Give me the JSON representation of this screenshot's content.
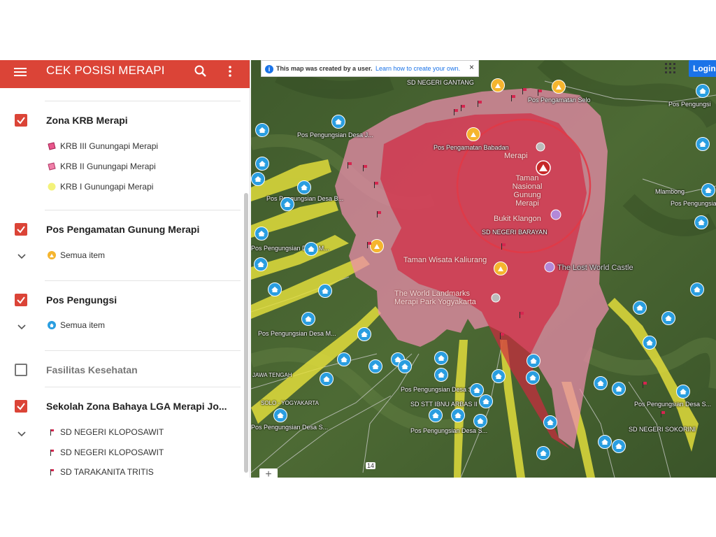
{
  "app": {
    "title": "CEK POSISI MERAPI"
  },
  "layers": [
    {
      "title": "Zona KRB Merapi",
      "checked": true,
      "items": [
        {
          "label": "KRB III Gunungapi Merapi",
          "color": "#e8578c"
        },
        {
          "label": "KRB II Gunungapi Merapi",
          "color": "#ef7fa8"
        },
        {
          "label": "KRB I Gunungapi Merapi",
          "color": "#f3f27a"
        }
      ]
    },
    {
      "title": "Pos Pengamatan Gunung Merapi",
      "checked": true,
      "items": [
        {
          "label": "Semua item",
          "icon": "volcano-post-icon"
        }
      ]
    },
    {
      "title": "Pos Pengungsi",
      "checked": true,
      "items": [
        {
          "label": "Semua item",
          "icon": "home-icon"
        }
      ]
    },
    {
      "title": "Fasilitas Kesehatan",
      "checked": false,
      "items": []
    },
    {
      "title": "Sekolah Zona Bahaya LGA Merapi Jo...",
      "checked": true,
      "items": [
        {
          "label": "SD NEGERI KLOPOSAWIT"
        },
        {
          "label": "SD NEGERI KLOPOSAWIT"
        },
        {
          "label": "SD TARAKANITA TRITIS"
        }
      ]
    }
  ],
  "map": {
    "banner_text": "This map was created by a user.",
    "banner_link": "Learn how to create your own.",
    "login": "Login",
    "zoom_in": "+",
    "colors": {
      "krb3": "#d3263f",
      "krb2": "#ee8eae",
      "krb1": "#e6e13c",
      "accent": "#db4437",
      "marker_blue": "#2a9ee0"
    },
    "labels": {
      "sd_gantang": "SD NEGERI GANTANG",
      "pos_selo": "Pos Pengamatan Selo",
      "pos_pengungsi_right_1": "Pos Pengungsi",
      "pos_babadan": "Pos Pengamatan Babadan",
      "merapi_peak": "Merapi",
      "taman_nasional": "Taman Nasional Gunung Merapi",
      "bukit_klangon": "Bukit Klangon",
      "sd_barayan": "SD NEGERI BARAYAN",
      "taman_wisata": "Taman Wisata Kaliurang",
      "lost_world": "The Lost World Castle",
      "world_landmarks": "The World Landmarks Merapi Park Yogyakarta",
      "mlambong": "Mlambong",
      "pos_desa_j": "Pos Pengungsian Desa J...",
      "pos_desa_b": "Pos Pengungsian Desa B...",
      "pos_desa_m": "Pos Pengungsian Desa M...",
      "pos_desa_s": "Pos Pengungsian Desa S...",
      "sd_jarbas": "SD STT IBNU ARBAS II",
      "sd_sokorini": "SD NEGERI SOKORINI",
      "pos_desa_right": "Pos Pengungsian Desa S...",
      "road_14": "14",
      "road_tengah": "JAWA TENGAH",
      "road_yogyakarta": "SOLO - YOGYAKARTA"
    }
  }
}
